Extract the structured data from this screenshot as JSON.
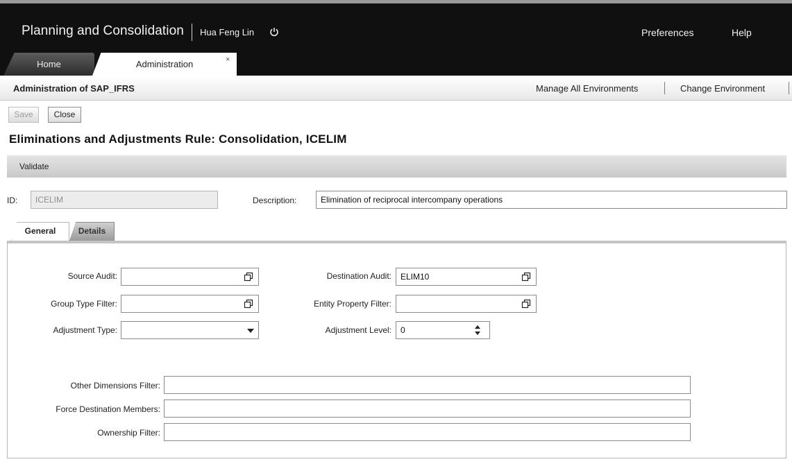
{
  "header": {
    "app_title": "Planning and Consolidation",
    "user_name": "Hua Feng Lin",
    "preferences": "Preferences",
    "help": "Help"
  },
  "tabs": [
    {
      "label": "Home"
    },
    {
      "label": "Administration",
      "close": "×"
    }
  ],
  "subheader": {
    "title": "Administration of SAP_IFRS",
    "manage_all": "Manage All Environments",
    "change_env": "Change Environment"
  },
  "toolbar": {
    "save_label": "Save",
    "close_label": "Close"
  },
  "page_title": "Eliminations and Adjustments Rule: Consolidation, ICELIM",
  "validate_label": "Validate",
  "form": {
    "id_label": "ID:",
    "id_value": "ICELIM",
    "description_label": "Description:",
    "description_value": "Elimination of reciprocal intercompany operations"
  },
  "detail_tabs": [
    {
      "label": "General"
    },
    {
      "label": "Details"
    }
  ],
  "general": {
    "source_audit_label": "Source Audit:",
    "source_audit_value": "",
    "destination_audit_label": "Destination Audit:",
    "destination_audit_value": "ELIM10",
    "group_type_filter_label": "Group Type Filter:",
    "group_type_filter_value": "",
    "entity_property_filter_label": "Entity Property Filter:",
    "entity_property_filter_value": "",
    "adjustment_type_label": "Adjustment Type:",
    "adjustment_type_value": "",
    "adjustment_level_label": "Adjustment Level:",
    "adjustment_level_value": "0",
    "other_dimensions_filter_label": "Other Dimensions Filter:",
    "other_dimensions_filter_value": "",
    "force_destination_members_label": "Force Destination Members:",
    "force_destination_members_value": "",
    "ownership_filter_label": "Ownership Filter:",
    "ownership_filter_value": ""
  }
}
